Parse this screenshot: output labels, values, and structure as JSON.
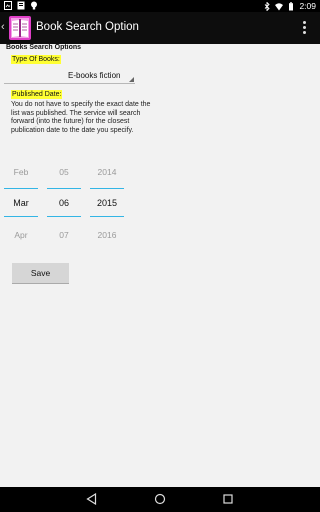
{
  "action_bar": {
    "title": "Book Search Option"
  },
  "status_bar": {
    "time": "2:09"
  },
  "form": {
    "section_title": "Books Search Options",
    "type_label": "Type Of Books:",
    "type_value": "E-books fiction",
    "date_label": "Published Date:",
    "description": "You do not have to specify the exact date the list was published. The service will search forward (into the future) for the closest publication date to the date you specify.",
    "picker": {
      "month": {
        "prev": "Feb",
        "current": "Mar",
        "next": "Apr"
      },
      "day": {
        "prev": "05",
        "current": "06",
        "next": "07"
      },
      "year": {
        "prev": "2014",
        "current": "2015",
        "next": "2016"
      }
    },
    "save_label": "Save"
  },
  "colors": {
    "highlight": "#ffff33",
    "picker_accent": "#33b5e5",
    "app_icon": "#e040c8"
  }
}
